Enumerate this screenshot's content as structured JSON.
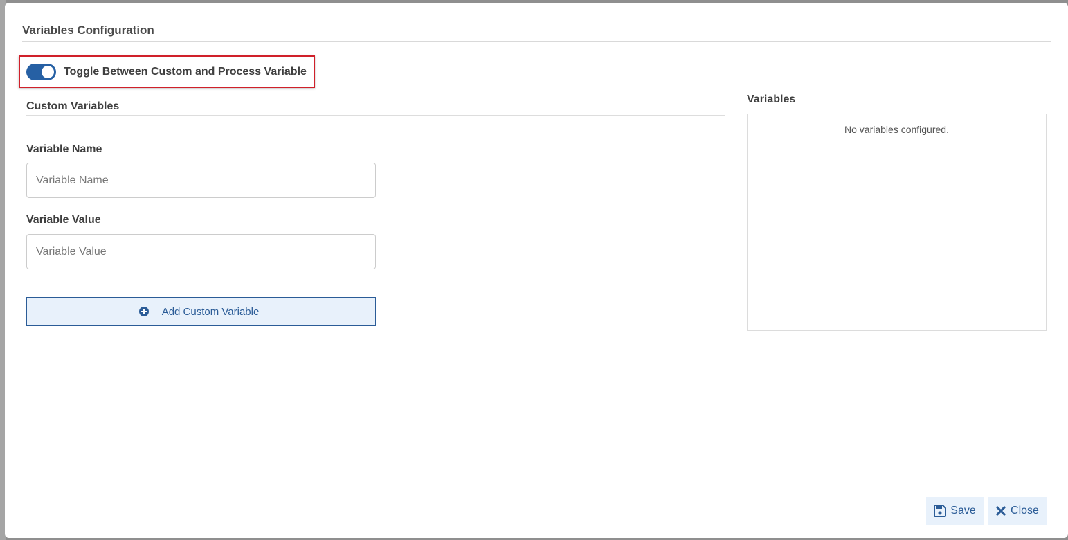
{
  "modal": {
    "title": "Variables Configuration"
  },
  "toggle": {
    "label": "Toggle Between Custom and Process Variable",
    "checked": true
  },
  "custom_variables": {
    "section_title": "Custom Variables",
    "name_label": "Variable Name",
    "name_placeholder": "Variable Name",
    "name_value": "",
    "value_label": "Variable Value",
    "value_placeholder": "Variable Value",
    "value_value": "",
    "add_button_label": "Add Custom Variable"
  },
  "variables_panel": {
    "title": "Variables",
    "empty_message": "No variables configured."
  },
  "footer": {
    "save_label": "Save",
    "close_label": "Close"
  },
  "colors": {
    "primary": "#2b5c97",
    "toggle_on": "#2660a4",
    "button_bg": "#e8f1fb",
    "highlight": "#d0202a"
  },
  "icons": {
    "add": "plus-circle-icon",
    "save": "floppy-disk-icon",
    "close": "close-x-icon"
  }
}
